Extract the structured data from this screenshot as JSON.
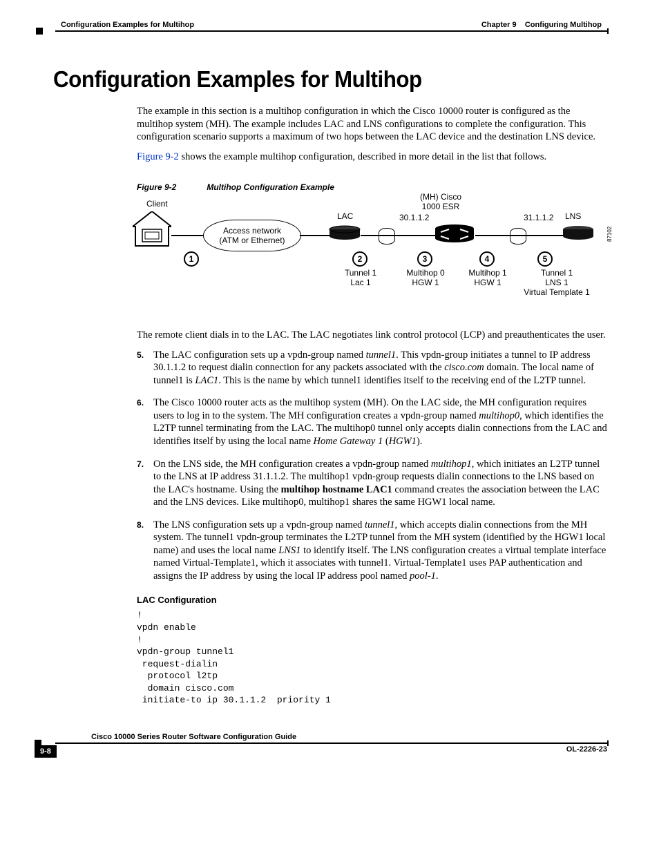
{
  "header": {
    "left": "Configuration Examples for Multihop",
    "right_chapter": "Chapter 9",
    "right_title": "Configuring Multihop"
  },
  "title": "Configuration Examples for Multihop",
  "intro1": "The example in this section is a multihop configuration in which the Cisco 10000 router is configured as the multihop system (MH). The example includes LAC and LNS configurations to complete the configuration. This configuration scenario supports a maximum of two hops between the LAC device and the destination LNS device.",
  "intro2_link": "Figure 9-2",
  "intro2_rest": " shows the example multihop configuration, described in more detail in the list that follows.",
  "figure": {
    "num": "Figure 9-2",
    "caption": "Multihop Configuration Example",
    "client": "Client",
    "access1": "Access network",
    "access2": "(ATM or Ethernet)",
    "lac": "LAC",
    "mh1": "(MH) Cisco",
    "mh2": "1000 ESR",
    "ip1": "30.1.1.2",
    "ip2": "31.1.1.2",
    "lns": "LNS",
    "n1": "1",
    "n2": "2",
    "n3": "3",
    "n4": "4",
    "n5": "5",
    "c2a": "Tunnel 1",
    "c2b": "Lac 1",
    "c3a": "Multihop 0",
    "c3b": "HGW 1",
    "c4a": "Multihop 1",
    "c4b": "HGW 1",
    "c5a": "Tunnel 1",
    "c5b": "LNS 1",
    "c5c": "Virtual Template 1",
    "imgid": "87102"
  },
  "para2": "The remote client dials in to the LAC. The LAC negotiates link control protocol (LCP) and preauthenticates the user.",
  "steps": [
    {
      "parts": [
        {
          "t": "The LAC configuration sets up a vpdn-group named "
        },
        {
          "t": "tunnel1",
          "i": true
        },
        {
          "t": ". This vpdn-group initiates a tunnel to IP address 30.1.1.2 to request dialin connection for any packets associated with the "
        },
        {
          "t": "cisco.com",
          "i": true
        },
        {
          "t": " domain. The local name of tunnel1 is "
        },
        {
          "t": "LAC1",
          "i": true
        },
        {
          "t": ". This is the name by which tunnel1 identifies itself to the receiving end of the L2TP tunnel."
        }
      ]
    },
    {
      "parts": [
        {
          "t": "The Cisco 10000 router acts as the multihop system (MH). On the LAC side, the MH configuration requires users to log in to the system. The MH configuration creates a vpdn-group named "
        },
        {
          "t": "multihop0",
          "i": true
        },
        {
          "t": ", which identifies the L2TP tunnel terminating from the LAC. The multihop0 tunnel only accepts dialin connections from the LAC and identifies itself by using the local name "
        },
        {
          "t": "Home Gateway 1",
          "i": true
        },
        {
          "t": " ("
        },
        {
          "t": "HGW1",
          "i": true
        },
        {
          "t": ")."
        }
      ]
    },
    {
      "parts": [
        {
          "t": "On the LNS side, the MH configuration creates a vpdn-group named "
        },
        {
          "t": "multihop1",
          "i": true
        },
        {
          "t": ", which initiates an L2TP tunnel to the LNS at IP address 31.1.1.2. The multihop1 vpdn-group requests dialin connections to the LNS based on the LAC's hostname. Using the "
        },
        {
          "t": "multihop hostname LAC1",
          "b": true
        },
        {
          "t": " command creates the association between the LAC and the LNS devices. Like multihop0, multihop1 shares the same HGW1 local name."
        }
      ]
    },
    {
      "parts": [
        {
          "t": "The LNS configuration sets up a vpdn-group named "
        },
        {
          "t": "tunnel1",
          "i": true
        },
        {
          "t": ", which accepts dialin connections from the MH system. The tunnel1 vpdn-group terminates the L2TP tunnel from the MH system (identified by the HGW1 local name) and uses the local name "
        },
        {
          "t": "LNS1",
          "i": true
        },
        {
          "t": " to identify itself. The LNS configuration creates a virtual template interface named Virtual-Template1, which it associates with tunnel1. Virtual-Template1 uses PAP authentication and assigns the IP address by using the local IP address pool named "
        },
        {
          "t": "pool-1",
          "i": true
        },
        {
          "t": "."
        }
      ]
    }
  ],
  "lac_head": "LAC Configuration",
  "code": "!\nvpdn enable\n!\nvpdn-group tunnel1\n request-dialin\n  protocol l2tp\n  domain cisco.com\n initiate-to ip 30.1.1.2  priority 1",
  "footer": {
    "guide": "Cisco 10000 Series Router Software Configuration Guide",
    "page": "9-8",
    "docid": "OL-2226-23"
  }
}
